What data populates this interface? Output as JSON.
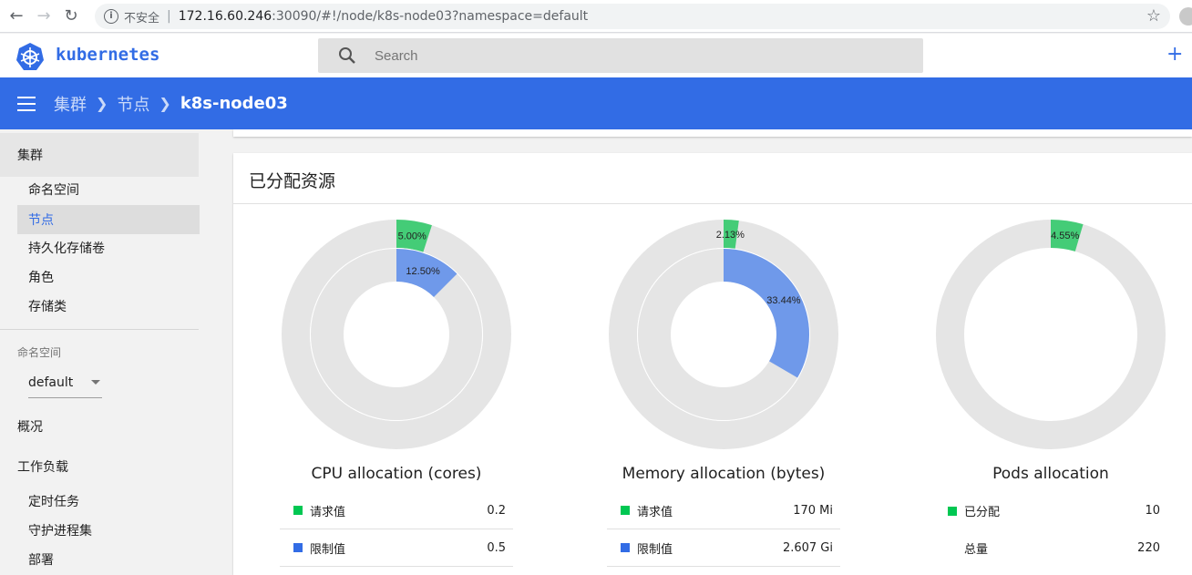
{
  "browser": {
    "insecure_label": "不安全",
    "separator": "|",
    "url_host": "172.16.60.246",
    "url_rest": ":30090/#!/node/k8s-node03?namespace=default"
  },
  "header": {
    "brand": "kubernetes",
    "search_placeholder": "Search",
    "create_label": "+"
  },
  "toolbar": {
    "breadcrumbs": [
      "集群",
      "节点",
      "k8s-node03"
    ]
  },
  "sidebar": {
    "cluster_header": "集群",
    "cluster_items": [
      "命名空间",
      "节点",
      "持久化存储卷",
      "角色",
      "存储类"
    ],
    "selected_item": "节点",
    "namespace_label": "命名空间",
    "namespace_value": "default",
    "overview": "概况",
    "workloads_header": "工作负载",
    "workload_items": [
      "定时任务",
      "守护进程集",
      "部署"
    ]
  },
  "card": {
    "title": "已分配资源"
  },
  "colors": {
    "accent": "#326ce5",
    "green": "#00c752",
    "green_chart": "#44cc77",
    "blue_chart": "#6f99ea",
    "ring_gray": "#e5e5e5"
  },
  "charts": [
    {
      "title": "CPU allocation (cores)",
      "outer_percent": 5.0,
      "outer_label": "5.00%",
      "inner_percent": 12.5,
      "inner_label": "12.50%",
      "legend": [
        {
          "name": "请求值",
          "value": "0.2",
          "swatch": "green"
        },
        {
          "name": "限制值",
          "value": "0.5",
          "swatch": "blue"
        }
      ]
    },
    {
      "title": "Memory allocation (bytes)",
      "outer_percent": 2.13,
      "outer_label": "2.13%",
      "inner_percent": 33.44,
      "inner_label": "33.44%",
      "legend": [
        {
          "name": "请求值",
          "value": "170 Mi",
          "swatch": "green"
        },
        {
          "name": "限制值",
          "value": "2.607 Gi",
          "swatch": "blue"
        }
      ]
    },
    {
      "title": "Pods allocation",
      "outer_percent": 4.55,
      "outer_label": "4.55%",
      "legend": [
        {
          "name": "已分配",
          "value": "10",
          "swatch": "green"
        },
        {
          "name": "总量",
          "value": "220",
          "swatch": "none"
        }
      ]
    }
  ]
}
